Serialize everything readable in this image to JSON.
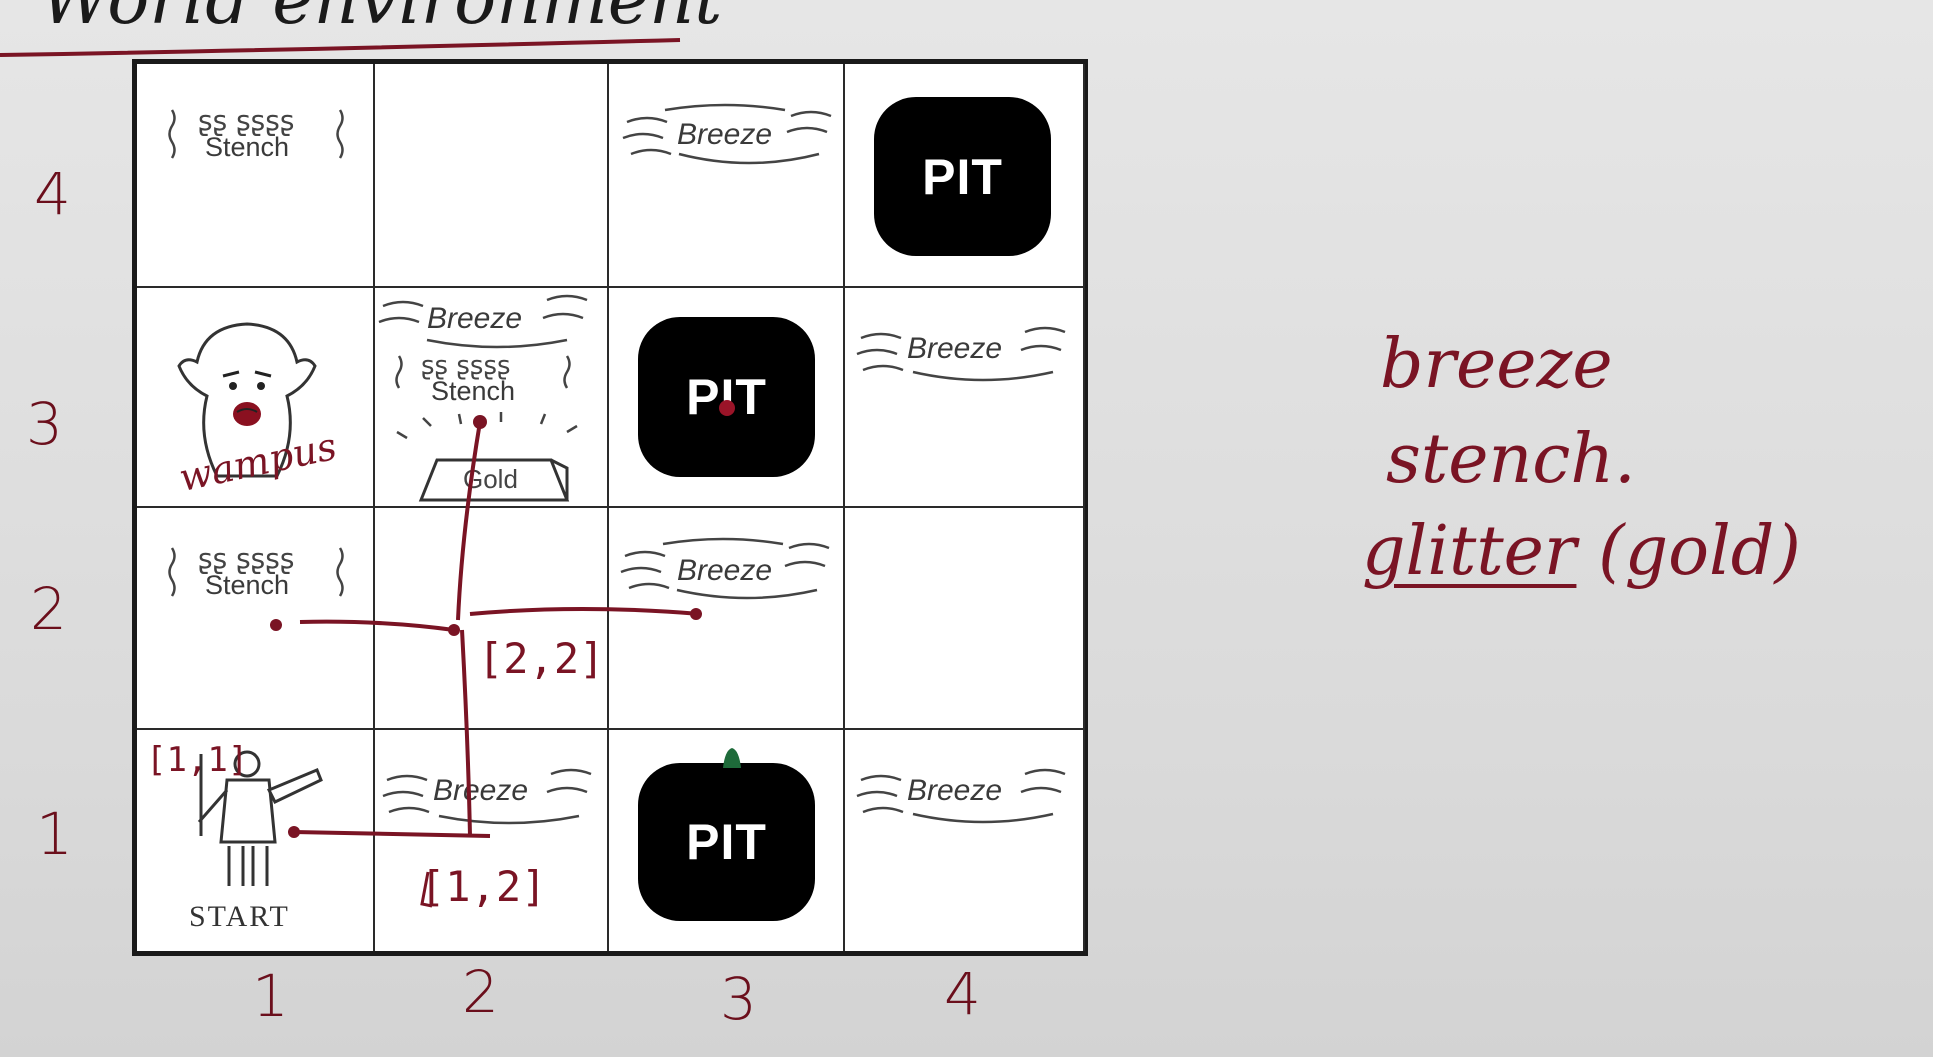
{
  "title": "World environment",
  "row_labels": [
    "4",
    "3",
    "2",
    "1"
  ],
  "col_labels": [
    "1",
    "2",
    "3",
    "4"
  ],
  "board": {
    "pit_label": "PIT",
    "breeze_label": "Breeze",
    "stench_label": "Stench",
    "gold_label": "Gold",
    "start_label": "START"
  },
  "annotations": {
    "wumpus": "wampus",
    "cell_1_1": "[1,1]",
    "cell_1_2": "[1,2]",
    "cell_2_2": "[2,2]"
  },
  "notes": {
    "line1": "breeze",
    "line2": "stench.",
    "line3_underlined": "glitter",
    "line3_rest": "(gold)"
  },
  "colors": {
    "ink": "#7a1424",
    "pit": "#000000",
    "board_line": "#1a1a1a"
  }
}
